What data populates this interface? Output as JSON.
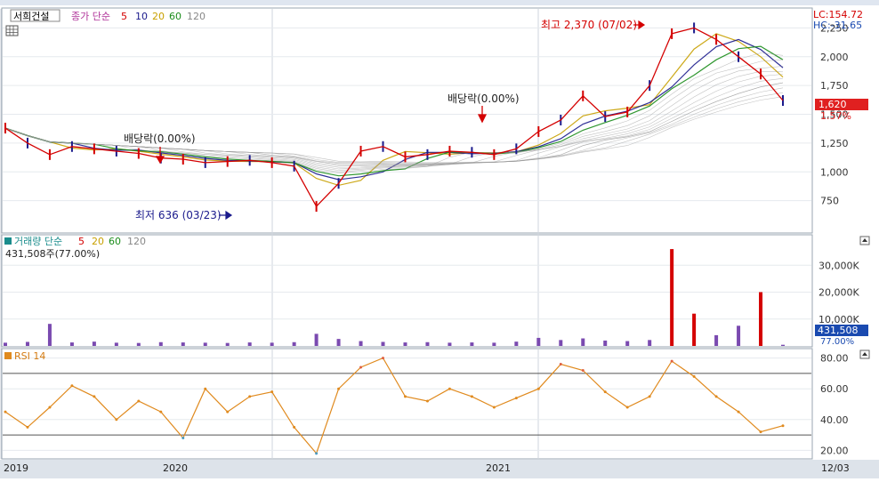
{
  "stock_name": "서희건설",
  "price_indicator": {
    "label": "종가 단순",
    "periods": [
      "5",
      "10",
      "20",
      "60",
      "120"
    ]
  },
  "volume_indicator": {
    "label": "거래량 단순",
    "periods": [
      "5",
      "20",
      "60",
      "120"
    ]
  },
  "volume_current": "431,508주(77.00%)",
  "rsi_label": "RSI 14",
  "lc_label": "LC:154.72",
  "hc_label": "HC:-31.65",
  "current_price": "1,620",
  "current_change": "1.57%",
  "current_volume": "431,508",
  "current_volume_pct": "77.00%",
  "annotations": {
    "high": "최고 2,370 (07/02)",
    "low": "최저 636 (03/23)",
    "dividend1": "배당락(0.00%)",
    "dividend2": "배당락(0.00%)"
  },
  "x_labels": [
    "2019",
    "2020",
    "2021"
  ],
  "x_end_label": "12/03",
  "colors": {
    "ma5": "#d40000",
    "ma10": "#1a1a8c",
    "ma20": "#c8a000",
    "ma60": "#1a8c1a",
    "ma120": "#888888",
    "rsi": "#e08a1e",
    "highlight": "#e03030"
  },
  "chart_data": [
    {
      "type": "line",
      "ylabel": "",
      "ylim": [
        500,
        2400
      ],
      "yticks": [
        "2,250",
        "2,000",
        "1,750",
        "1,500",
        "1,250",
        "1,000",
        "750"
      ],
      "ytick_values": [
        2250,
        2000,
        1750,
        1500,
        1250,
        1000,
        750
      ],
      "x": [
        "2019-01",
        "2019-02",
        "2019-03",
        "2019-04",
        "2019-05",
        "2019-06",
        "2019-07",
        "2019-08",
        "2019-09",
        "2019-10",
        "2019-11",
        "2019-12",
        "2020-01",
        "2020-02",
        "2020-03",
        "2020-04",
        "2020-05",
        "2020-06",
        "2020-07",
        "2020-08",
        "2020-09",
        "2020-10",
        "2020-11",
        "2020-12",
        "2021-01",
        "2021-02",
        "2021-03",
        "2021-04",
        "2021-05",
        "2021-06",
        "2021-07",
        "2021-08",
        "2021-09",
        "2021-10",
        "2021-11",
        "2021-12"
      ],
      "series": [
        {
          "name": "종가",
          "values": [
            1380,
            1250,
            1150,
            1220,
            1200,
            1180,
            1160,
            1120,
            1110,
            1080,
            1090,
            1100,
            1080,
            1050,
            700,
            900,
            1180,
            1220,
            1130,
            1150,
            1180,
            1170,
            1150,
            1200,
            1350,
            1450,
            1660,
            1480,
            1520,
            1750,
            2200,
            2250,
            2150,
            2000,
            1850,
            1620
          ]
        }
      ]
    },
    {
      "type": "bar",
      "ylabel": "",
      "ylim": [
        0,
        40000
      ],
      "yticks": [
        "30,000K",
        "20,000K",
        "10,000K"
      ],
      "ytick_values": [
        30000,
        20000,
        10000
      ],
      "x": [
        "2019-01",
        "2019-02",
        "2019-03",
        "2019-04",
        "2019-05",
        "2019-06",
        "2019-07",
        "2019-08",
        "2019-09",
        "2019-10",
        "2019-11",
        "2019-12",
        "2020-01",
        "2020-02",
        "2020-03",
        "2020-04",
        "2020-05",
        "2020-06",
        "2020-07",
        "2020-08",
        "2020-09",
        "2020-10",
        "2020-11",
        "2020-12",
        "2021-01",
        "2021-02",
        "2021-03",
        "2021-04",
        "2021-05",
        "2021-06",
        "2021-07",
        "2021-08",
        "2021-09",
        "2021-10",
        "2021-11",
        "2021-12"
      ],
      "series": [
        {
          "name": "거래량",
          "values": [
            1200,
            1500,
            8200,
            1300,
            1600,
            1200,
            1100,
            1400,
            1300,
            1200,
            1100,
            1300,
            1200,
            1400,
            4500,
            2600,
            1800,
            1500,
            1300,
            1400,
            1200,
            1300,
            1200,
            1600,
            3000,
            2200,
            2800,
            2000,
            1800,
            2200,
            36000,
            12000,
            4000,
            7500,
            20000,
            431
          ]
        }
      ]
    },
    {
      "type": "line",
      "ylabel": "",
      "ylim": [
        15,
        85
      ],
      "yticks": [
        "80.00",
        "60.00",
        "40.00",
        "20.00"
      ],
      "ytick_values": [
        80,
        60,
        40,
        20
      ],
      "thresholds": [
        70,
        30
      ],
      "x": [
        "2019-01",
        "2019-02",
        "2019-03",
        "2019-04",
        "2019-05",
        "2019-06",
        "2019-07",
        "2019-08",
        "2019-09",
        "2019-10",
        "2019-11",
        "2019-12",
        "2020-01",
        "2020-02",
        "2020-03",
        "2020-04",
        "2020-05",
        "2020-06",
        "2020-07",
        "2020-08",
        "2020-09",
        "2020-10",
        "2020-11",
        "2020-12",
        "2021-01",
        "2021-02",
        "2021-03",
        "2021-04",
        "2021-05",
        "2021-06",
        "2021-07",
        "2021-08",
        "2021-09",
        "2021-10",
        "2021-11",
        "2021-12"
      ],
      "series": [
        {
          "name": "RSI 14",
          "values": [
            45,
            35,
            48,
            62,
            55,
            40,
            52,
            45,
            28,
            60,
            45,
            55,
            58,
            35,
            18,
            60,
            74,
            80,
            55,
            52,
            60,
            55,
            48,
            54,
            60,
            76,
            72,
            58,
            48,
            55,
            78,
            68,
            55,
            45,
            32,
            36
          ]
        }
      ]
    }
  ]
}
